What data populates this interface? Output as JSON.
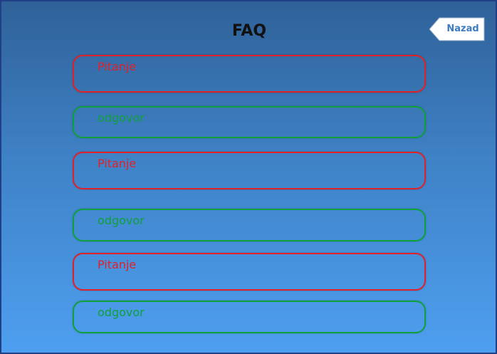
{
  "page": {
    "title": "FAQ",
    "back_label": "Nazad"
  },
  "faq": [
    {
      "question": "Pitanje",
      "answer": "odgovor"
    },
    {
      "question": "Pitanje",
      "answer": "odgovor"
    },
    {
      "question": "Pitanje",
      "answer": "odgovor"
    }
  ],
  "colors": {
    "question_border": "#e02128",
    "answer_border": "#10a03c",
    "background_top": "#2f6198",
    "background_bottom": "#4e9ff0"
  }
}
